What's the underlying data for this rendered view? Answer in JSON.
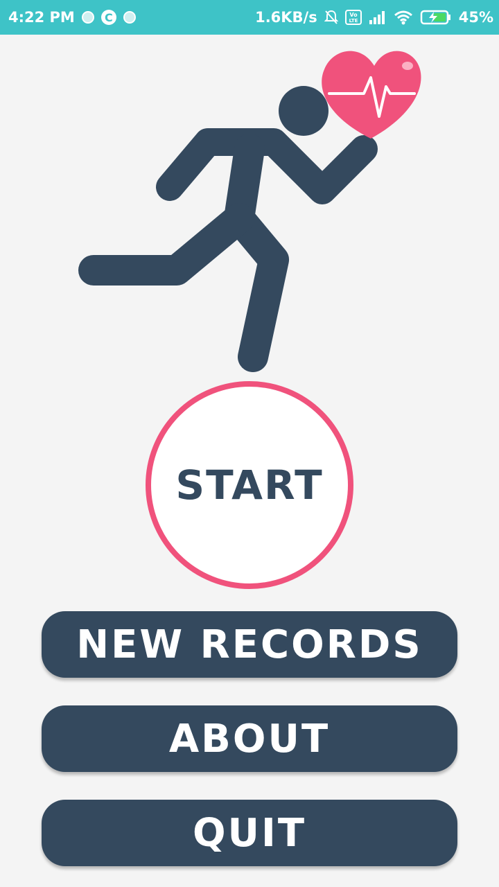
{
  "status_bar": {
    "time": "4:22 PM",
    "network_speed": "1.6KB/s",
    "battery_percent": "45%",
    "icons": [
      "notification-dot-icon",
      "c-app-icon",
      "notification-dot-icon",
      "muted-bell-icon",
      "volte-icon",
      "signal-icon",
      "wifi-icon",
      "battery-charging-icon"
    ]
  },
  "hero": {
    "icons": [
      "running-man-icon",
      "heart-pulse-icon"
    ],
    "colors": {
      "figure": "#34495e",
      "heart": "#f0527c"
    }
  },
  "start_button": {
    "label": "START",
    "ring_color": "#f0527c"
  },
  "menu": {
    "new_records": "NEW RECORDS",
    "about": "ABOUT",
    "quit": "QUIT"
  },
  "colors": {
    "status_bar": "#3ec3c7",
    "button": "#34495e",
    "background": "#f4f4f4"
  }
}
